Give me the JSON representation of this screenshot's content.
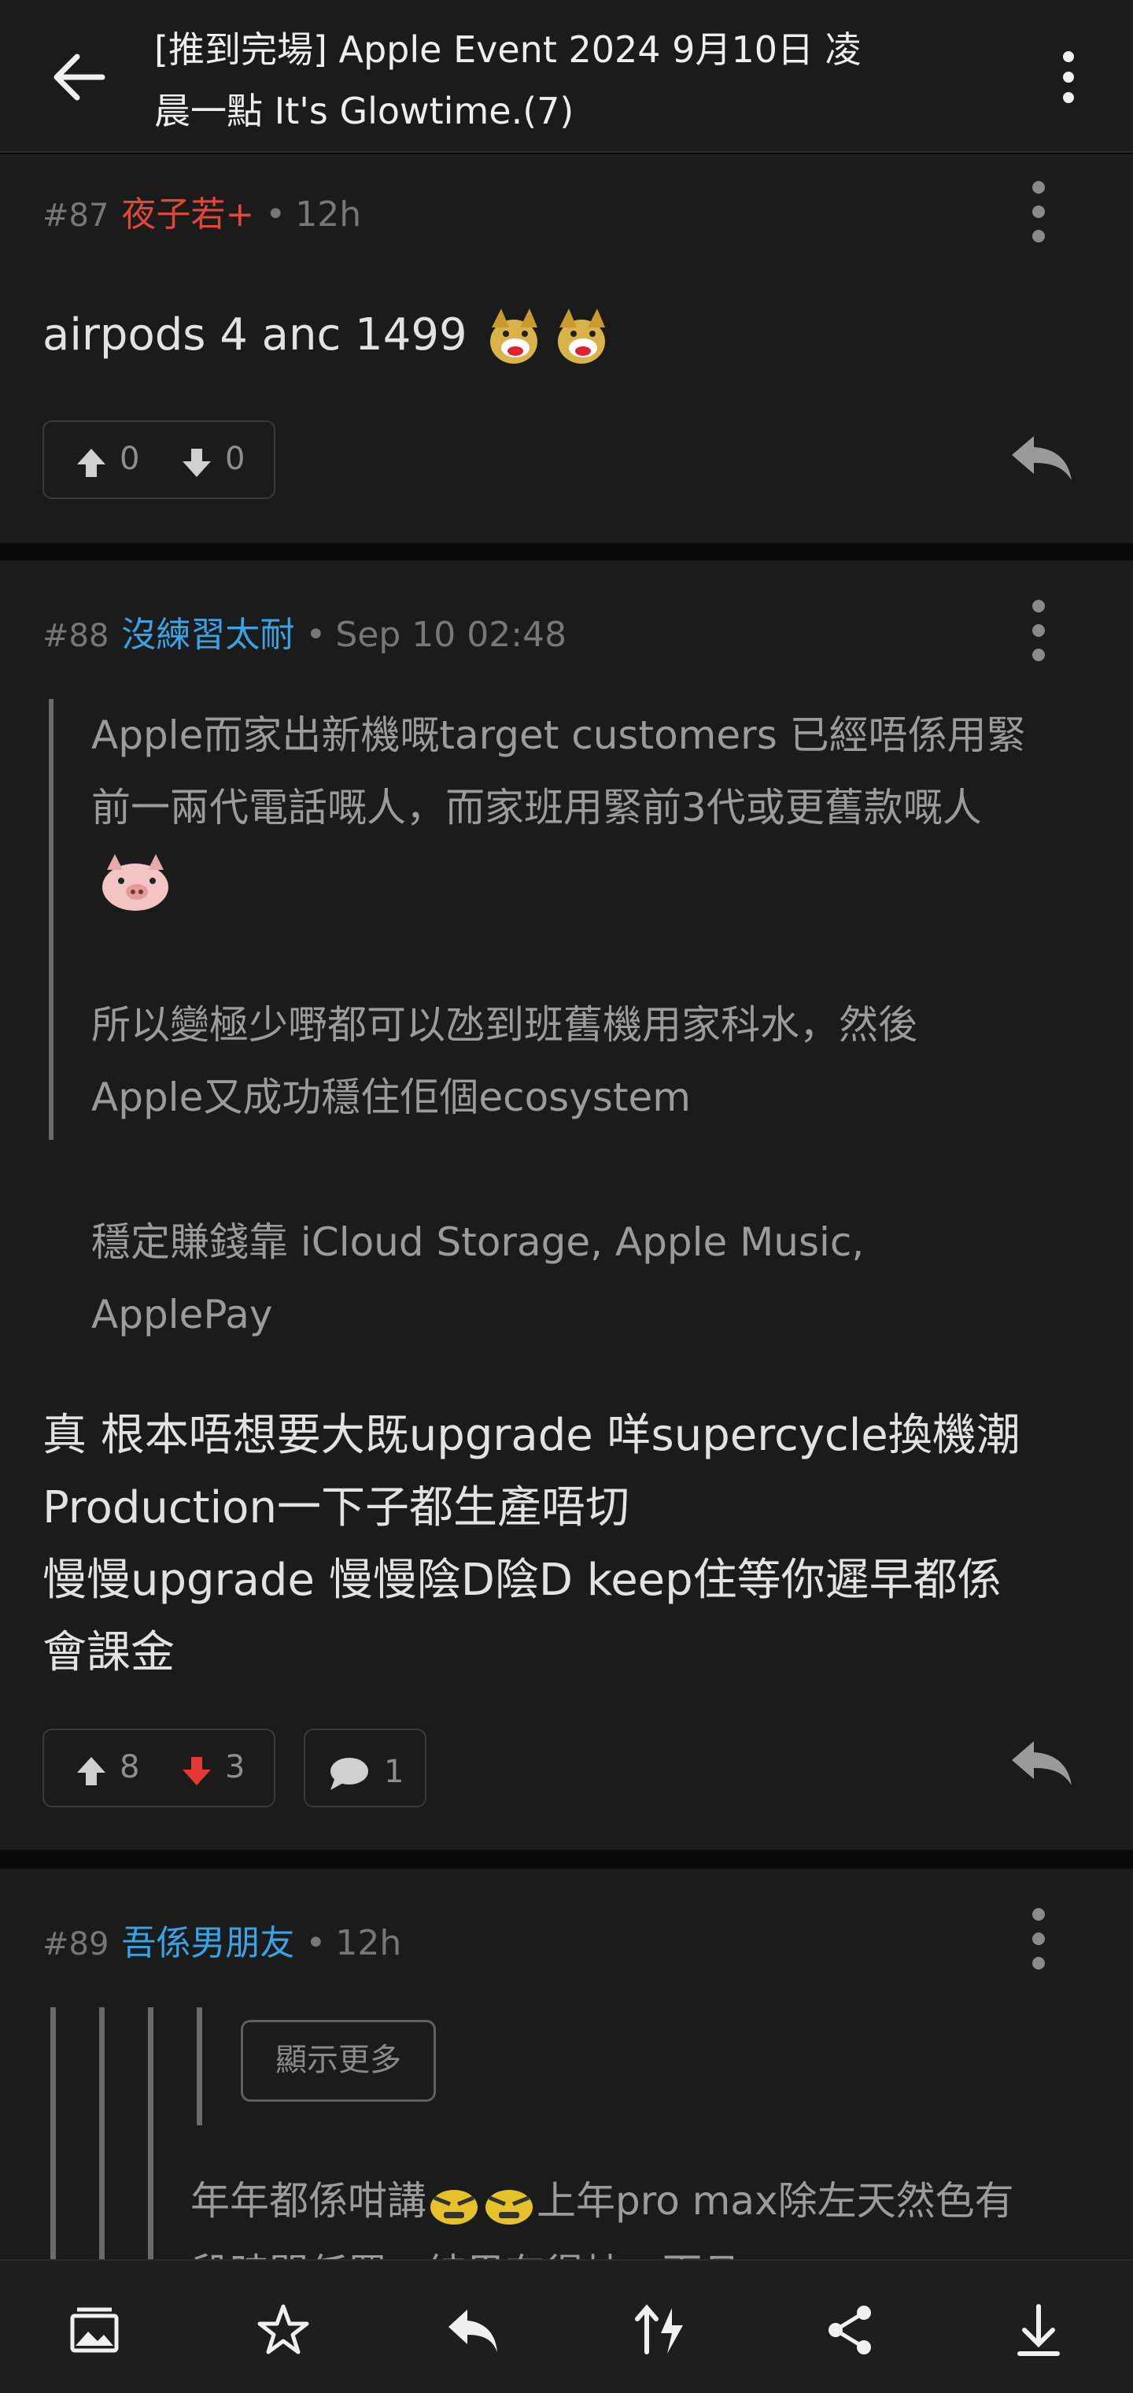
{
  "header": {
    "title_line1": "[推到完場] Apple  Event 2024 9月10日 凌",
    "title_line2": "晨一點 It's Glowtime.(7)"
  },
  "posts": [
    {
      "number": "#87",
      "author": "夜子若+",
      "author_color": "#e0463a",
      "time": "12h",
      "body": "airpods 4 anc 1499",
      "upvotes": "0",
      "downvotes": "0"
    },
    {
      "number": "#88",
      "author": "沒練習太耐",
      "author_color": "#3aa3e3",
      "time": "Sep 10 02:48",
      "quote_lines": [
        "Apple而家出新機嘅target customers 已經唔係用緊",
        "前一兩代電話嘅人，而家班用緊前3代或更舊款嘅人",
        "所以變極少嘢都可以氹到班舊機用家科水，然後",
        "Apple又成功穩住佢個ecosystem",
        "穩定賺錢靠 iCloud Storage, Apple Music,",
        "ApplePay"
      ],
      "body_lines": [
        "真 根本唔想要大既upgrade 咩supercycle換機潮",
        "Production一下子都生產唔切",
        "慢慢upgrade 慢慢陰D陰D keep住等你遲早都係",
        "會課金"
      ],
      "upvotes": "8",
      "downvotes": "3",
      "downvote_color": "#e53935",
      "replies": "1"
    },
    {
      "number": "#89",
      "author": "吾係男朋友",
      "author_color": "#3aa3e3",
      "time": "12h",
      "show_more_label": "顯示更多",
      "quote_line1_a": "年年都係咁講",
      "quote_line1_b": "上年pro max除左天然色有",
      "quote_line2_partial": "段時間任買，結果有得炒，而且"
    }
  ],
  "bottom_bar": {
    "icons": [
      "image-gallery-icon",
      "star-icon",
      "reply-icon",
      "sort-icon",
      "share-icon",
      "download-icon"
    ]
  }
}
